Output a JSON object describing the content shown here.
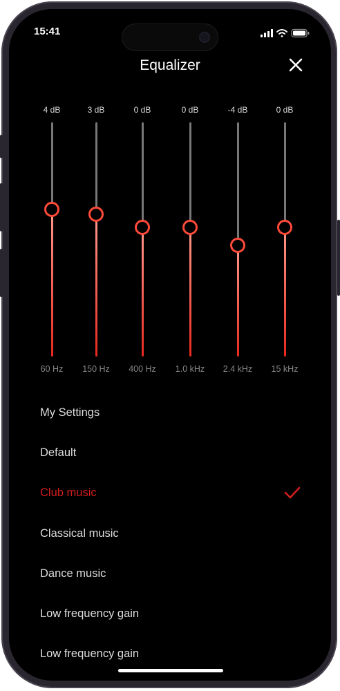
{
  "status_bar": {
    "time": "15:41"
  },
  "header": {
    "title": "Equalizer"
  },
  "equalizer": {
    "min_db": -12,
    "max_db": 12,
    "bands": [
      {
        "value_label": "4 dB",
        "db": 4,
        "freq": "60 Hz"
      },
      {
        "value_label": "3 dB",
        "db": 3,
        "freq": "150 Hz"
      },
      {
        "value_label": "0 dB",
        "db": 0,
        "freq": "400 Hz"
      },
      {
        "value_label": "0 dB",
        "db": 0,
        "freq": "1.0 kHz"
      },
      {
        "value_label": "-4 dB",
        "db": -4,
        "freq": "2.4 kHz"
      },
      {
        "value_label": "0 dB",
        "db": 0,
        "freq": "15 kHz"
      }
    ]
  },
  "presets": [
    {
      "label": "My Settings"
    },
    {
      "label": "Default"
    },
    {
      "label": "Club music",
      "selected": true
    },
    {
      "label": "Classical music"
    },
    {
      "label": "Dance music"
    },
    {
      "label": "Low frequency gain"
    },
    {
      "label": "Low frequency gain"
    }
  ],
  "colors": {
    "accent": "#d21e1e",
    "knob": "#ff4a3a",
    "background": "#000000"
  },
  "icons": {
    "close": "close-icon",
    "check": "checkmark-icon",
    "signal": "signal-icon",
    "wifi": "wifi-icon",
    "battery": "battery-icon"
  }
}
